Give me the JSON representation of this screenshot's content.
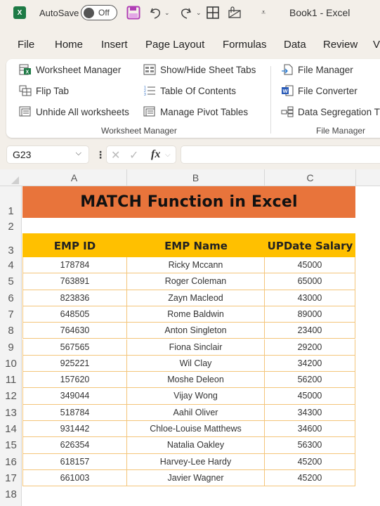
{
  "titlebar": {
    "app_icon": "excel-logo-icon",
    "autosave_label": "AutoSave",
    "autosave_state": "Off",
    "icons": [
      "save-icon",
      "undo-icon",
      "redo-icon",
      "table-borders-icon",
      "email-attach-icon",
      "customize-toolbar-icon"
    ],
    "document_title": "Book1  -  Excel"
  },
  "menu": {
    "items": [
      "File",
      "Home",
      "Insert",
      "Page Layout",
      "Formulas",
      "Data",
      "Review",
      "V"
    ]
  },
  "ribbon": {
    "groups": [
      {
        "label": "Worksheet Manager",
        "items": [
          {
            "label": "Worksheet Manager",
            "icon": "worksheet-manager-icon"
          },
          {
            "label": "Flip Tab",
            "icon": "flip-tab-icon"
          },
          {
            "label": "Unhide All worksheets",
            "icon": "unhide-worksheets-icon"
          },
          {
            "label": "Show/Hide Sheet Tabs",
            "icon": "sheet-tabs-icon"
          },
          {
            "label": "Table Of Contents",
            "icon": "table-of-contents-icon"
          },
          {
            "label": "Manage Pivot Tables",
            "icon": "pivot-tables-icon"
          }
        ]
      },
      {
        "label": "File Manager",
        "items": [
          {
            "label": "File Manager",
            "icon": "file-manager-icon"
          },
          {
            "label": "File Converter",
            "icon": "file-converter-icon"
          },
          {
            "label": "Data Segregation T",
            "icon": "data-segregation-icon"
          }
        ]
      }
    ]
  },
  "formula_bar": {
    "name_box": "G23",
    "formula": ""
  },
  "sheet": {
    "columns": [
      "A",
      "B",
      "C"
    ],
    "rows": [
      "1",
      "2",
      "3",
      "4",
      "5",
      "6",
      "7",
      "8",
      "9",
      "10",
      "11",
      "12",
      "13",
      "14",
      "15",
      "16",
      "17",
      "18"
    ],
    "title": "MATCH Function in Excel",
    "title_color": "#e8743b",
    "header_color": "#ffc000",
    "headers": [
      "EMP ID",
      "EMP Name",
      "UPDate Salary"
    ],
    "data": [
      [
        "178784",
        "Ricky Mccann",
        "45000"
      ],
      [
        "763891",
        "Roger Coleman",
        "65000"
      ],
      [
        "823836",
        "Zayn Macleod",
        "43000"
      ],
      [
        "648505",
        "Rome Baldwin",
        "89000"
      ],
      [
        "764630",
        "Anton Singleton",
        "23400"
      ],
      [
        "567565",
        "Fiona Sinclair",
        "29200"
      ],
      [
        "925221",
        "Wil Clay",
        "34200"
      ],
      [
        "157620",
        "Moshe Deleon",
        "56200"
      ],
      [
        "349044",
        "Vijay Wong",
        "45000"
      ],
      [
        "518784",
        "Aahil Oliver",
        "34300"
      ],
      [
        "931442",
        "Chloe-Louise Matthews",
        "34600"
      ],
      [
        "626354",
        "Natalia Oakley",
        "56300"
      ],
      [
        "618157",
        "Harvey-Lee Hardy",
        "45200"
      ],
      [
        "661003",
        "Javier Wagner",
        "45200"
      ]
    ]
  }
}
